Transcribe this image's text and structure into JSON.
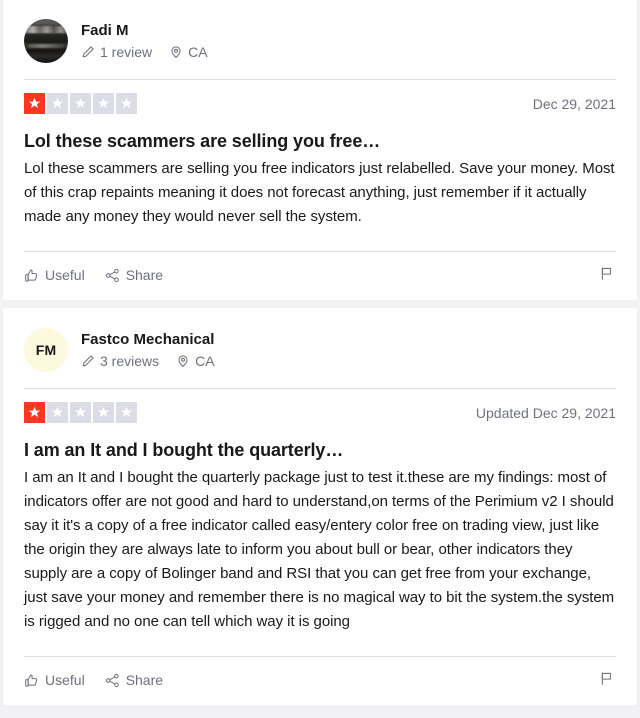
{
  "theme": {
    "page_background": "#f2f2f5",
    "card_background": "#ffffff",
    "star_filled_color": "#ff3722",
    "star_empty_color": "#dcdce6",
    "text_primary": "#191919",
    "text_muted": "#6f6f80",
    "divider_color": "#dcdce6",
    "initials_avatar_background": "#fdf9df"
  },
  "reviews": [
    {
      "avatar": {
        "type": "photo",
        "name": "consumer-avatar-photo",
        "initials": ""
      },
      "consumer_name": "Fadi M",
      "reviews_count_label": "1 review",
      "location_label": "CA",
      "reviews_icon": "pencil-icon",
      "location_icon": "map-pin-icon",
      "rating": 1,
      "max_rating": 5,
      "rating_label": "Rated 1 out of 5 stars",
      "date_label": "Dec 29, 2021",
      "title": "Lol these scammers are selling you free…",
      "body": "Lol these scammers are selling you free indicators just relabelled. Save your money. Most of this crap repaints meaning it does not forecast anything, just remember if it actually made any money they would never sell the system.",
      "useful_label": "Useful",
      "share_label": "Share",
      "useful_icon": "thumbs-up-icon",
      "share_icon": "share-nodes-icon",
      "report_icon": "flag-icon"
    },
    {
      "avatar": {
        "type": "initials",
        "name": "consumer-avatar-initials",
        "initials": "FM"
      },
      "consumer_name": "Fastco Mechanical",
      "reviews_count_label": "3 reviews",
      "location_label": "CA",
      "reviews_icon": "pencil-icon",
      "location_icon": "map-pin-icon",
      "rating": 1,
      "max_rating": 5,
      "rating_label": "Rated 1 out of 5 stars",
      "date_label": "Updated Dec 29, 2021",
      "title": "I am an It and I bought the quarterly…",
      "body": "I am an It and I bought the quarterly package just to test it.these are my findings: most of indicators offer are not good and hard to understand,on terms of the Perimium v2 I should say it it's a copy of a free indicator called easy/entery color free on trading view, just like the origin they are always late to inform you about bull or bear, other indicators they supply are a copy of Bolinger band and RSI that you can get free from your exchange, just save your money and remember there is no magical way to bit the system.the system is rigged and no one can tell which way it is going",
      "useful_label": "Useful",
      "share_label": "Share",
      "useful_icon": "thumbs-up-icon",
      "share_icon": "share-nodes-icon",
      "report_icon": "flag-icon"
    }
  ]
}
